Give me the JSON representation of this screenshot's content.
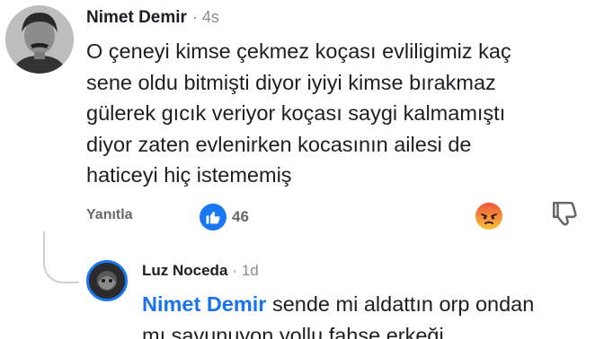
{
  "comment": {
    "author": "Nimet Demir",
    "time": "· 4s",
    "text": "O çeneyi kimse çekmez koçası evliligimiz  kaç\nsene oldu bitmişti diyor iyiyi kimse bırakmaz\ngülerek gıcık  veriyor  koçası saygi kalmamıştı\ndiyor  zaten  evlenirken kocasının   ailesi de\nhaticeyi hiç istememiş",
    "reply_label": "Yanıtla",
    "like_count": "46",
    "icons": {
      "avatar": "profile-photo",
      "like": "thumbs-up-icon",
      "angry": "angry-reaction-icon",
      "dislike": "thumbs-down-icon"
    },
    "colors": {
      "accent": "#1877f2",
      "meta": "#8a8d91"
    }
  },
  "reply": {
    "author": "Luz Noceda",
    "time": "· 1d",
    "mention": "Nimet Demir",
    "text_line1": " sende mi aldattın orp ondan",
    "text_line2": "mı savunuyon yollu fahşe erkeği",
    "colors": {
      "mention": "#1a73e8"
    }
  }
}
